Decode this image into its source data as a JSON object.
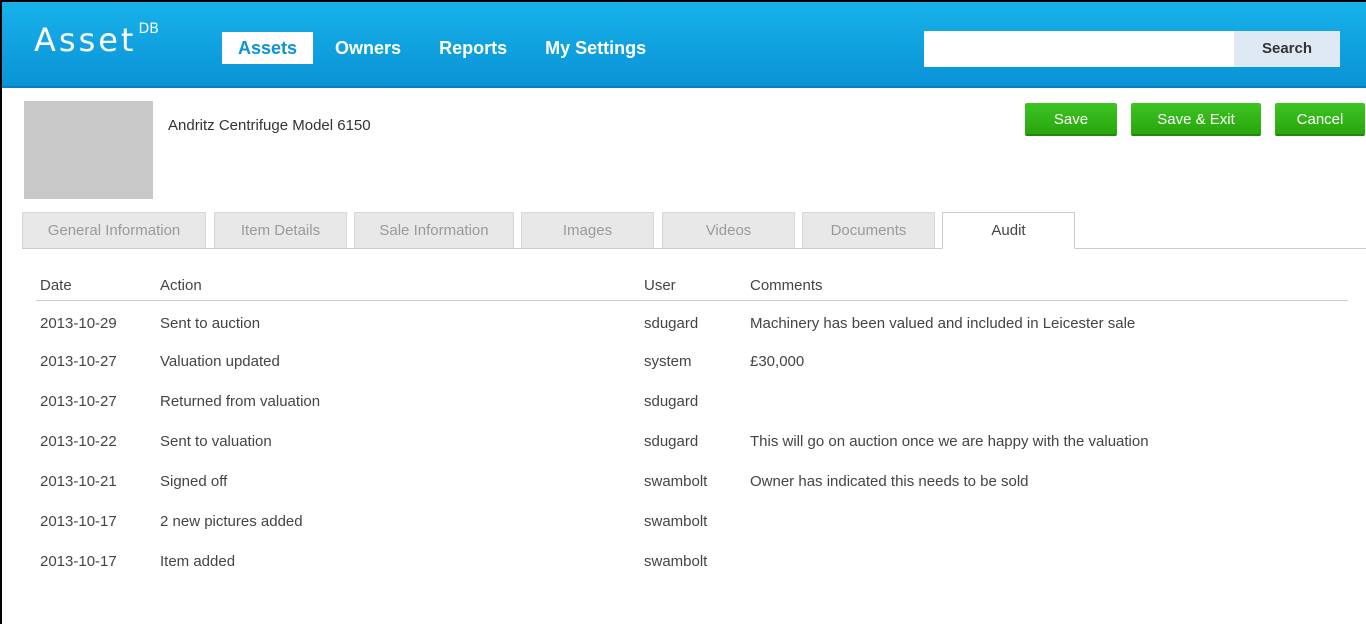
{
  "header": {
    "logo_text": "Asset",
    "logo_sup": "DB",
    "nav": [
      {
        "label": "Assets",
        "active": true
      },
      {
        "label": "Owners",
        "active": false
      },
      {
        "label": "Reports",
        "active": false
      },
      {
        "label": "My Settings",
        "active": false
      }
    ],
    "search_value": "",
    "search_button": "Search"
  },
  "item": {
    "title": "Andritz Centrifuge Model 6150",
    "thumbnail_icon": "image-placeholder-icon"
  },
  "actions": {
    "save": "Save",
    "save_exit": "Save & Exit",
    "cancel": "Cancel"
  },
  "tabs": [
    {
      "label": "General Information",
      "active": false
    },
    {
      "label": "Item Details",
      "active": false
    },
    {
      "label": "Sale Information",
      "active": false
    },
    {
      "label": "Images",
      "active": false
    },
    {
      "label": "Videos",
      "active": false
    },
    {
      "label": "Documents",
      "active": false
    },
    {
      "label": "Audit",
      "active": true
    }
  ],
  "audit": {
    "columns": {
      "date": "Date",
      "action": "Action",
      "user": "User",
      "comments": "Comments"
    },
    "rows": [
      {
        "date": "2013-10-29",
        "action": "Sent to auction",
        "user": "sdugard",
        "comments": "Machinery has been valued and included in Leicester sale"
      },
      {
        "date": "2013-10-27",
        "action": "Valuation updated",
        "user": "system",
        "comments": "£30,000"
      },
      {
        "date": "2013-10-27",
        "action": "Returned from valuation",
        "user": "sdugard",
        "comments": ""
      },
      {
        "date": "2013-10-22",
        "action": "Sent to valuation",
        "user": "sdugard",
        "comments": "This will go on auction once we are happy with the valuation"
      },
      {
        "date": "2013-10-21",
        "action": "Signed off",
        "user": "swambolt",
        "comments": "Owner has indicated this needs to be sold"
      },
      {
        "date": "2013-10-17",
        "action": "2 new pictures added",
        "user": "swambolt",
        "comments": ""
      },
      {
        "date": "2013-10-17",
        "action": "Item added",
        "user": "swambolt",
        "comments": ""
      }
    ]
  },
  "colors": {
    "header_blue": "#0a93d6",
    "button_green": "#2aa60f",
    "tab_inactive": "#e8e8e8"
  }
}
